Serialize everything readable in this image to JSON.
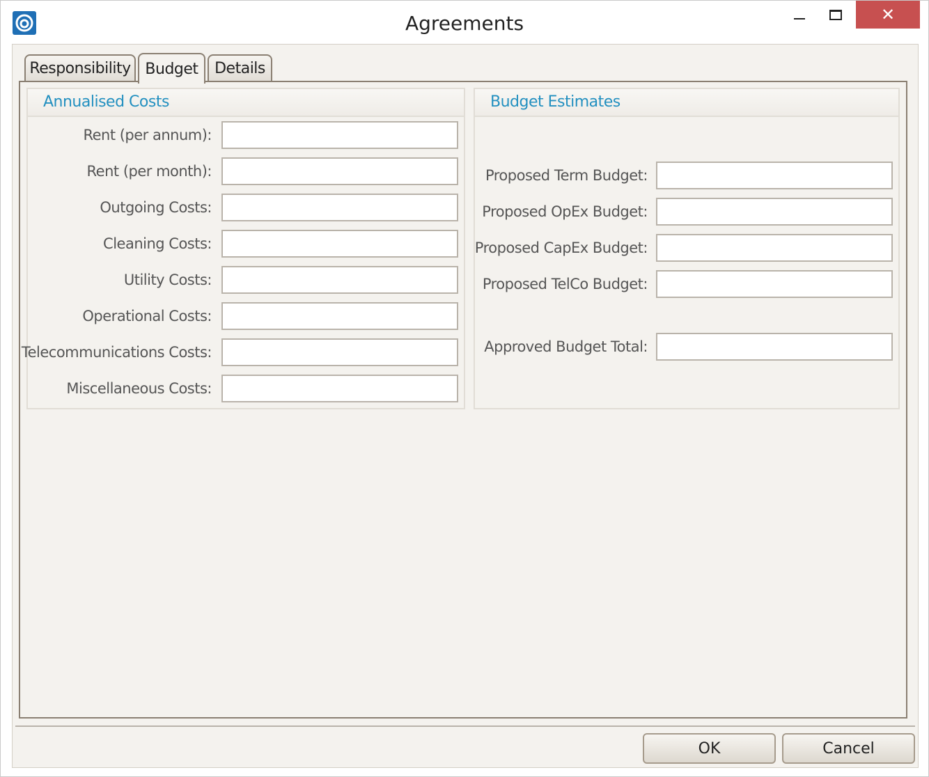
{
  "window": {
    "title": "Agreements",
    "close_glyph": "✕"
  },
  "tabs": [
    {
      "label": "Responsibility",
      "active": false
    },
    {
      "label": "Budget",
      "active": true
    },
    {
      "label": "Details",
      "active": false
    }
  ],
  "annualised": {
    "title": "Annualised Costs",
    "fields": [
      {
        "label": "Rent (per annum):",
        "value": ""
      },
      {
        "label": "Rent (per month):",
        "value": ""
      },
      {
        "label": "Outgoing Costs:",
        "value": ""
      },
      {
        "label": "Cleaning Costs:",
        "value": ""
      },
      {
        "label": "Utility Costs:",
        "value": ""
      },
      {
        "label": "Operational Costs:",
        "value": ""
      },
      {
        "label": "Telecommunications Costs:",
        "value": ""
      },
      {
        "label": "Miscellaneous Costs:",
        "value": ""
      }
    ]
  },
  "estimates": {
    "title": "Budget Estimates",
    "fields": [
      {
        "label": "Proposed Term Budget:",
        "value": ""
      },
      {
        "label": "Proposed OpEx Budget:",
        "value": ""
      },
      {
        "label": "Proposed CapEx Budget:",
        "value": ""
      },
      {
        "label": "Proposed TelCo Budget:",
        "value": ""
      },
      {
        "label": "Approved Budget Total:",
        "value": ""
      }
    ]
  },
  "buttons": {
    "ok": "OK",
    "cancel": "Cancel"
  },
  "colors": {
    "accent": "#2390c0",
    "close_button": "#c75050",
    "app_icon": "#1f6fb5"
  }
}
